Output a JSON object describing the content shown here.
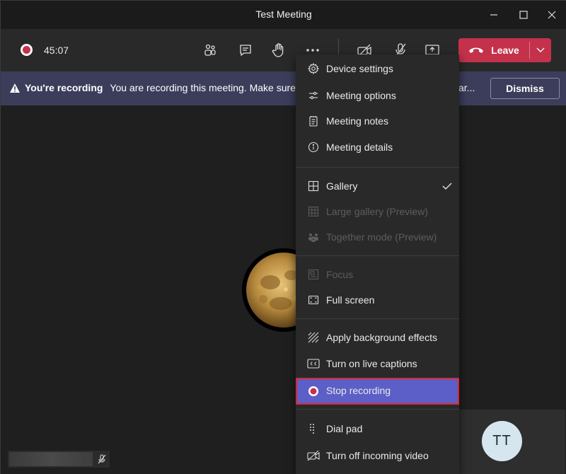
{
  "window": {
    "title": "Test Meeting",
    "minimize_icon": "minimize-icon",
    "maximize_icon": "maximize-icon",
    "close_icon": "close-icon"
  },
  "toolbar": {
    "timer": "45:07",
    "leave_label": "Leave",
    "icons": [
      "people-icon",
      "chat-icon",
      "raise-hand-icon",
      "more-icon",
      "camera-off-icon",
      "mic-off-icon",
      "share-screen-icon"
    ]
  },
  "banner": {
    "title": "You're recording",
    "message": "You are recording this meeting. Make sure t",
    "truncated_tail": "ar...",
    "dismiss_label": "Dismiss"
  },
  "menu": {
    "groups": [
      [
        {
          "label": "Device settings",
          "icon": "gear-icon"
        },
        {
          "label": "Meeting options",
          "icon": "sliders-icon"
        },
        {
          "label": "Meeting notes",
          "icon": "notes-icon"
        },
        {
          "label": "Meeting details",
          "icon": "info-icon"
        }
      ],
      [
        {
          "label": "Gallery",
          "icon": "grid-icon",
          "checked": true
        },
        {
          "label": "Large gallery (Preview)",
          "icon": "large-grid-icon",
          "disabled": true
        },
        {
          "label": "Together mode (Preview)",
          "icon": "together-icon",
          "disabled": true
        }
      ],
      [
        {
          "label": "Focus",
          "icon": "focus-icon",
          "disabled": true
        },
        {
          "label": "Full screen",
          "icon": "fullscreen-icon"
        }
      ],
      [
        {
          "label": "Apply background effects",
          "icon": "background-effects-icon"
        },
        {
          "label": "Turn on live captions",
          "icon": "captions-icon"
        },
        {
          "label": "Stop recording",
          "icon": "record-icon",
          "highlighted": true
        }
      ],
      [
        {
          "label": "Dial pad",
          "icon": "dialpad-icon"
        },
        {
          "label": "Turn off incoming video",
          "icon": "video-off-icon"
        }
      ]
    ]
  },
  "participants": {
    "self_initials": "TT"
  },
  "colors": {
    "accent": "#5b5fc7",
    "leave": "#c4314b",
    "banner": "#3c3d5b",
    "highlight_border": "#e0242c"
  }
}
